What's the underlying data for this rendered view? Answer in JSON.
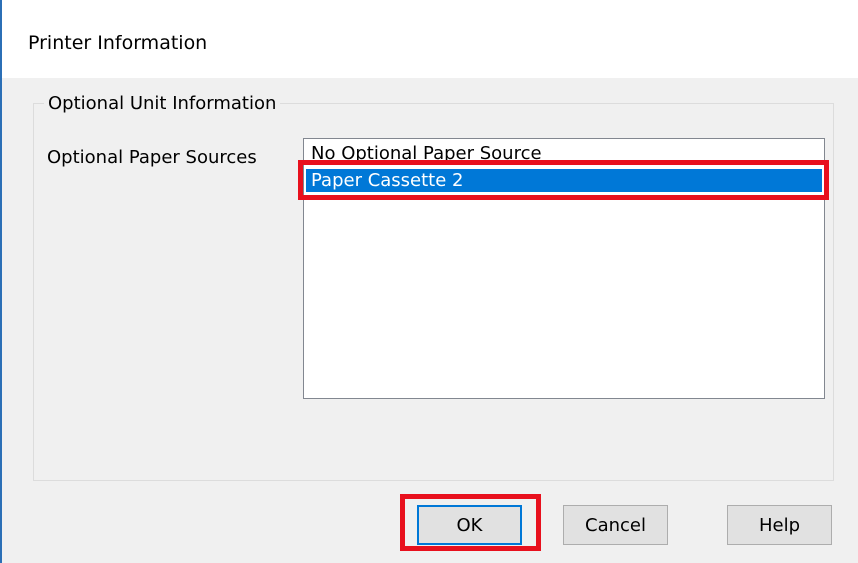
{
  "dialog": {
    "title": "Printer Information"
  },
  "group": {
    "legend": "Optional Unit Information",
    "field_label": "Optional Paper Sources",
    "list_items": [
      {
        "label": "No Optional Paper Source",
        "selected": false
      },
      {
        "label": "Paper Cassette 2",
        "selected": true
      }
    ]
  },
  "buttons": {
    "ok_label": "OK",
    "cancel_label": "Cancel",
    "help_label": "Help"
  },
  "colors": {
    "selection": "#0078d7",
    "callout_highlight": "#e8101d",
    "dialog_background": "#f0f0f0"
  }
}
